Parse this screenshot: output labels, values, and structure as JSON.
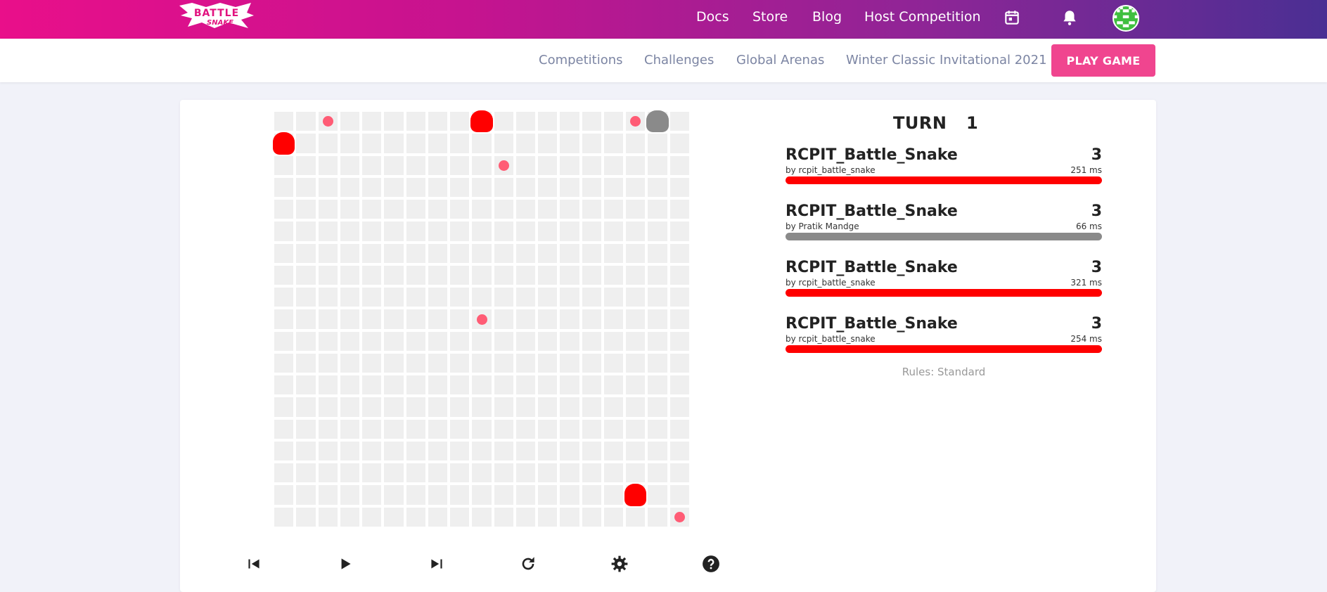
{
  "colors": {
    "brand_pink": "#f0458f",
    "food": "#ff5c75",
    "snake_red": "#ff0000",
    "snake_gray": "#8a8a8a",
    "cell": "#efefef"
  },
  "logo": {
    "text": "BATTLE SNAKE"
  },
  "topnav": {
    "links": [
      "Docs",
      "Store",
      "Blog",
      "Host Competition"
    ],
    "icons": [
      "calendar-icon",
      "bell-icon",
      "avatar"
    ]
  },
  "subnav": {
    "links": [
      "Competitions",
      "Challenges",
      "Global Arenas",
      "Winter Classic Invitational 2021"
    ],
    "play_button": "PLAY GAME"
  },
  "board": {
    "width": 19,
    "height": 19,
    "food": [
      [
        2,
        0
      ],
      [
        10,
        2
      ],
      [
        16,
        0
      ],
      [
        9,
        9
      ],
      [
        18,
        18
      ]
    ],
    "snakes": [
      {
        "head": [
          0,
          1
        ],
        "color": "#ff0000"
      },
      {
        "head": [
          9,
          0
        ],
        "color": "#ff0000"
      },
      {
        "head": [
          17,
          0
        ],
        "color": "#8a8a8a"
      },
      {
        "head": [
          16,
          17
        ],
        "color": "#ff0000"
      }
    ]
  },
  "controls": [
    "skip-back-icon",
    "play-icon",
    "skip-forward-icon",
    "replay-icon",
    "gear-icon",
    "help-icon"
  ],
  "scoreboard": {
    "turn_label": "TURN",
    "turn": "1",
    "snakes": [
      {
        "name": "RCPIT_Battle_Snake",
        "author": "by rcpit_battle_snake",
        "length": "3",
        "latency": "251 ms",
        "color": "#ff0000",
        "health": 1.0
      },
      {
        "name": "RCPIT_Battle_Snake",
        "author": "by Pratik Mandge",
        "length": "3",
        "latency": "66 ms",
        "color": "#8a8a8a",
        "health": 1.0
      },
      {
        "name": "RCPIT_Battle_Snake",
        "author": "by rcpit_battle_snake",
        "length": "3",
        "latency": "321 ms",
        "color": "#ff0000",
        "health": 1.0
      },
      {
        "name": "RCPIT_Battle_Snake",
        "author": "by rcpit_battle_snake",
        "length": "3",
        "latency": "254 ms",
        "color": "#ff0000",
        "health": 1.0
      }
    ],
    "rules": "Rules: Standard"
  }
}
